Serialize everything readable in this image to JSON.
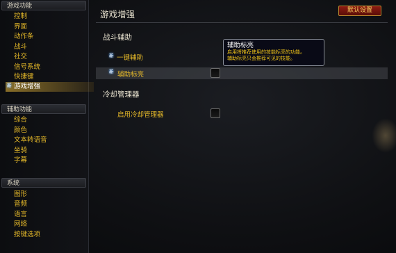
{
  "sidebar": {
    "sections": [
      {
        "title": "游戏功能",
        "items": [
          {
            "label": "控制"
          },
          {
            "label": "界面"
          },
          {
            "label": "动作条"
          },
          {
            "label": "战斗"
          },
          {
            "label": "社交"
          },
          {
            "label": "信号系统"
          },
          {
            "label": "快捷键"
          },
          {
            "label": "游戏增强",
            "selected": true,
            "badge": "新"
          }
        ]
      },
      {
        "title": "辅助功能",
        "items": [
          {
            "label": "综合"
          },
          {
            "label": "颜色"
          },
          {
            "label": "文本转语音"
          },
          {
            "label": "坐骑"
          },
          {
            "label": "字幕"
          }
        ]
      },
      {
        "title": "系统",
        "items": [
          {
            "label": "图形"
          },
          {
            "label": "音频"
          },
          {
            "label": "语言"
          },
          {
            "label": "网络"
          },
          {
            "label": "按键选项"
          }
        ]
      }
    ]
  },
  "main": {
    "title": "游戏增强",
    "defaults_button": "默认设置",
    "groups": [
      {
        "title": "战斗辅助",
        "options": [
          {
            "label": "一键辅助",
            "badge": "新",
            "has_checkbox": false
          },
          {
            "label": "辅助标亮",
            "badge": "新",
            "has_checkbox": true,
            "checked": false,
            "highlighted": true
          }
        ]
      },
      {
        "title": "冷却管理器",
        "options": [
          {
            "label": "启用冷却管理器",
            "has_checkbox": true,
            "checked": false
          }
        ]
      }
    ]
  },
  "tooltip": {
    "title": "辅助标亮",
    "lines": [
      "启用将推荐使用的技能标亮的功能。",
      "辅助标亮只会推荐可见的技能。"
    ]
  },
  "colors": {
    "accent_gold": "#e4b829",
    "selected_bar": "#f0be3c",
    "button_red": "#8e1c12",
    "new_badge_glow": "#58a6ff"
  }
}
